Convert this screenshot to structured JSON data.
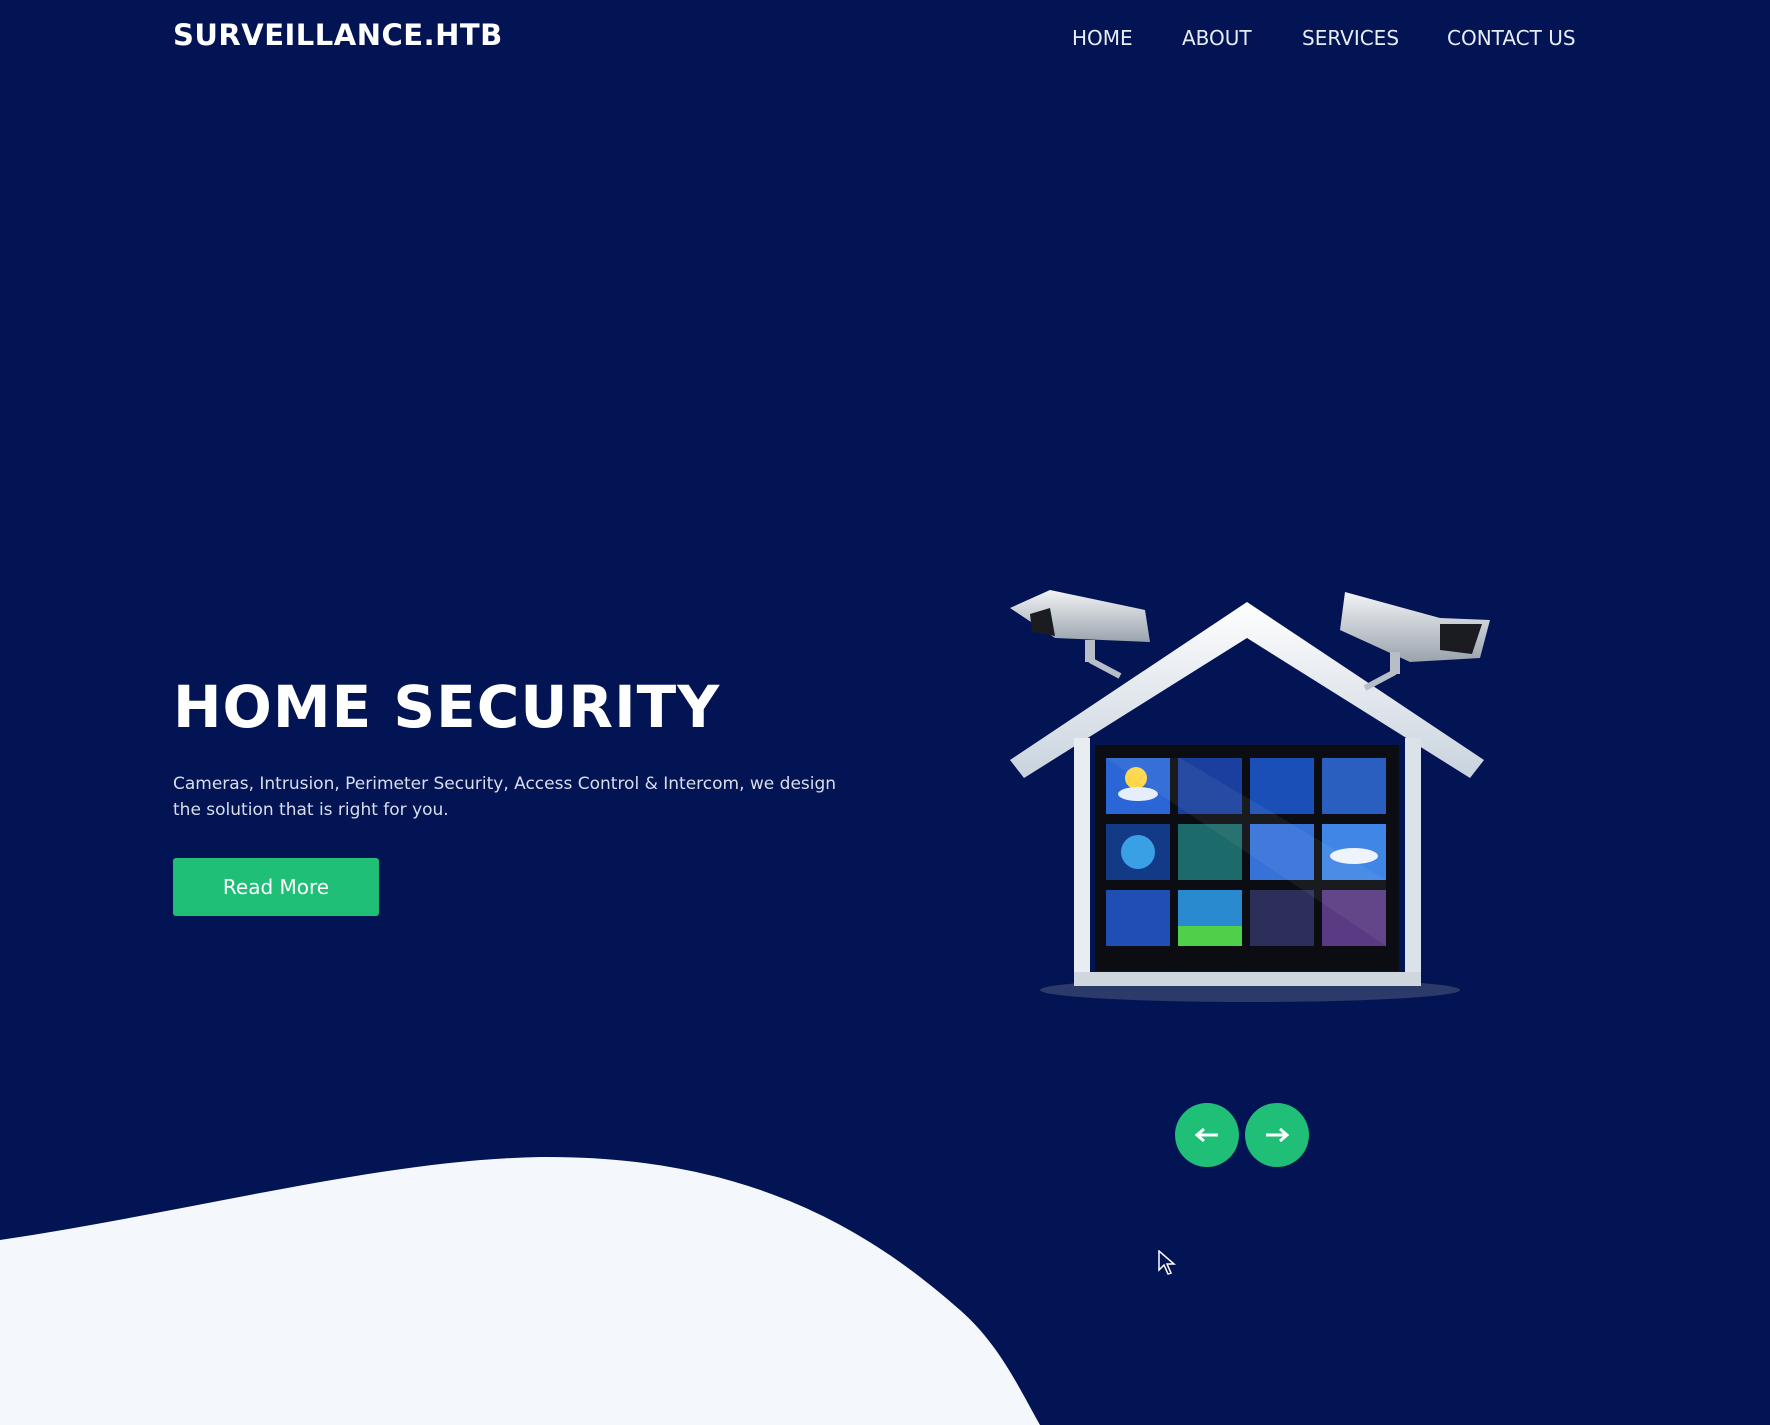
{
  "header": {
    "logo": "SURVEILLANCE.HTB",
    "nav": [
      "HOME",
      "ABOUT",
      "SERVICES",
      "CONTACT US"
    ]
  },
  "hero": {
    "title": "HOME SECURITY",
    "description": "Cameras, Intrusion, Perimeter Security, Access Control & Intercom, we design the solution that is right for you.",
    "button": "Read More"
  },
  "carousel": {
    "prev_icon": "arrow-left-icon",
    "next_icon": "arrow-right-icon"
  },
  "colors": {
    "background": "#021453",
    "accent": "#1fbf77",
    "wave": "#f4f7fb"
  }
}
